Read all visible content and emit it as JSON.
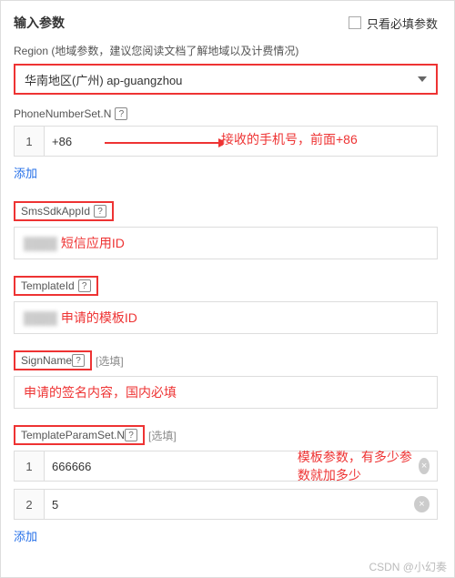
{
  "header": {
    "title": "输入参数",
    "requiredOnly": "只看必填参数"
  },
  "region": {
    "label": "Region (地域参数，建议您阅读文档了解地域以及计费情况)",
    "value": "华南地区(广州) ap-guangzhou"
  },
  "phone": {
    "label": "PhoneNumberSet.N",
    "rows": [
      {
        "idx": "1",
        "value": "+86"
      }
    ],
    "add": "添加",
    "annotation": "接收的手机号，前面+86"
  },
  "smsSdkAppId": {
    "label": "SmsSdkAppId",
    "annotation": "短信应用ID"
  },
  "templateId": {
    "label": "TemplateId",
    "annotation": "申请的模板ID"
  },
  "signName": {
    "label": "SignName",
    "optional": "[选填]",
    "annotation": "申请的签名内容，国内必填"
  },
  "templateParamSet": {
    "label": "TemplateParamSet.N",
    "optional": "[选填]",
    "rows": [
      {
        "idx": "1",
        "value": "666666"
      },
      {
        "idx": "2",
        "value": "5"
      }
    ],
    "add": "添加",
    "annotation": "模板参数，有多少参数就加多少"
  },
  "watermark": "CSDN @小幻奏"
}
